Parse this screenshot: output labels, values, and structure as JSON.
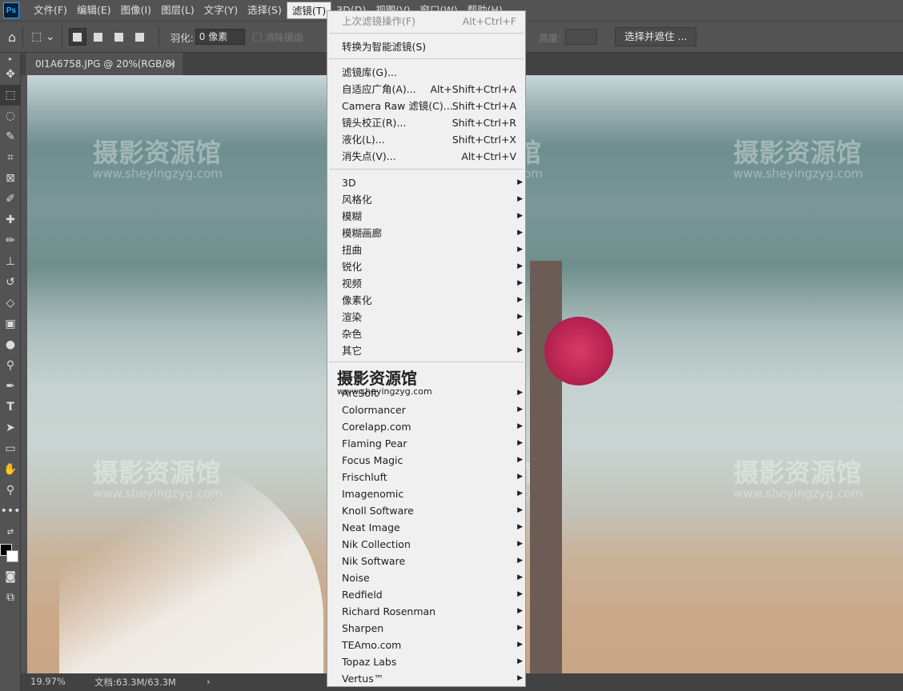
{
  "menubar": {
    "logo": "Ps",
    "items": [
      "文件(F)",
      "编辑(E)",
      "图像(I)",
      "图层(L)",
      "文字(Y)",
      "选择(S)",
      "滤镜(T)",
      "3D(D)",
      "视图(V)",
      "窗口(W)",
      "帮助(H)"
    ],
    "active_index": 6
  },
  "optionsbar": {
    "feather_label": "羽化:",
    "feather_value": "0 像素",
    "antialias_label": "消除锯齿",
    "height_label": "高度:",
    "select_mask_label": "选择并遮住 ..."
  },
  "document": {
    "tab_title": "0I1A6758.JPG @ 20%(RGB/8)",
    "tab_close": "×"
  },
  "watermark": {
    "text": "摄影资源馆",
    "url": "www.sheyingzyg.com"
  },
  "statusbar": {
    "zoom": "19.97%",
    "doc_size": "文档:63.3M/63.3M",
    "arrow": "›"
  },
  "filter_menu": {
    "group1": [
      {
        "label": "上次滤镜操作(F)",
        "shortcut": "Alt+Ctrl+F",
        "disabled": true
      }
    ],
    "group2": [
      {
        "label": "转换为智能滤镜(S)"
      }
    ],
    "group3": [
      {
        "label": "滤镜库(G)..."
      },
      {
        "label": "自适应广角(A)...",
        "shortcut": "Alt+Shift+Ctrl+A"
      },
      {
        "label": "Camera Raw 滤镜(C)...",
        "shortcut": "Shift+Ctrl+A"
      },
      {
        "label": "镜头校正(R)...",
        "shortcut": "Shift+Ctrl+R"
      },
      {
        "label": "液化(L)...",
        "shortcut": "Shift+Ctrl+X"
      },
      {
        "label": "消失点(V)...",
        "shortcut": "Alt+Ctrl+V"
      }
    ],
    "group4": [
      "3D",
      "风格化",
      "模糊",
      "模糊画廊",
      "扭曲",
      "锐化",
      "视频",
      "像素化",
      "渲染",
      "杂色",
      "其它"
    ],
    "menu_watermark": {
      "big": "摄影资源馆",
      "small": "www.sheyingzyg.com"
    },
    "group5": [
      "ArcSoft",
      "Colormancer",
      "Corelapp.com",
      "Flaming Pear",
      "Focus Magic",
      "Frischluft",
      "Imagenomic",
      "Knoll Software",
      "Neat Image",
      "Nik Collection",
      "Nik Software",
      "Noise",
      "Redfield",
      "Richard Rosenman",
      "Sharpen",
      "TEAmo.com",
      "Topaz Labs",
      "Vertus™"
    ],
    "submenu_arrow": "▶"
  }
}
